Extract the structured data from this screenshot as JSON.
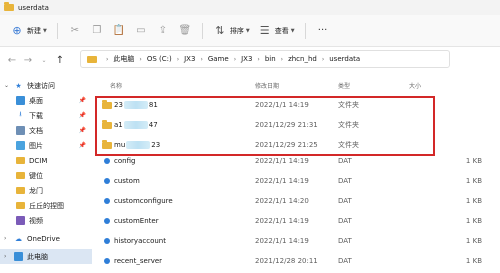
{
  "window": {
    "title": "userdata"
  },
  "toolbar": {
    "new_label": "新建",
    "sort_label": "排序",
    "view_label": "查看"
  },
  "address": {
    "crumbs": [
      "此电脑",
      "OS (C:)",
      "JX3",
      "Game",
      "JX3",
      "bin",
      "zhcn_hd",
      "userdata"
    ]
  },
  "sidebar": {
    "items": [
      {
        "label": "快速访问"
      },
      {
        "label": "桌面"
      },
      {
        "label": "下载"
      },
      {
        "label": "文档"
      },
      {
        "label": "图片"
      },
      {
        "label": "DCIM"
      },
      {
        "label": "键位"
      },
      {
        "label": "龙门"
      },
      {
        "label": "丘丘的捏图"
      },
      {
        "label": "视频"
      },
      {
        "label": "OneDrive"
      },
      {
        "label": "此电脑"
      }
    ]
  },
  "columns": {
    "name": "名称",
    "date": "修改日期",
    "type": "类型",
    "size": "大小"
  },
  "files": [
    {
      "name_prefix": "23",
      "name_suffix": "81",
      "date": "2022/1/1 14:19",
      "type": "文件夹",
      "size": ""
    },
    {
      "name_prefix": "a1",
      "name_suffix": "47",
      "date": "2021/12/29 21:31",
      "type": "文件夹",
      "size": ""
    },
    {
      "name_prefix": "mu",
      "name_suffix": "23",
      "date": "2021/12/29 21:25",
      "type": "文件夹",
      "size": ""
    },
    {
      "name": "config",
      "date": "2022/1/1 14:19",
      "type": "DAT",
      "size": "1 KB"
    },
    {
      "name": "custom",
      "date": "2022/1/1 14:19",
      "type": "DAT",
      "size": "1 KB"
    },
    {
      "name": "customconfigure",
      "date": "2022/1/1 14:20",
      "type": "DAT",
      "size": "1 KB"
    },
    {
      "name": "customEnter",
      "date": "2022/1/1 14:19",
      "type": "DAT",
      "size": "1 KB"
    },
    {
      "name": "historyaccount",
      "date": "2022/1/1 14:19",
      "type": "DAT",
      "size": "1 KB"
    },
    {
      "name": "recent_server",
      "date": "2021/12/28 20:11",
      "type": "DAT",
      "size": "1 KB"
    }
  ],
  "colors": {
    "highlight_border": "#d32828",
    "folder": "#e8b43a",
    "dat_icon": "#2f7ed8",
    "selected_bg": "#dbe6f3"
  }
}
